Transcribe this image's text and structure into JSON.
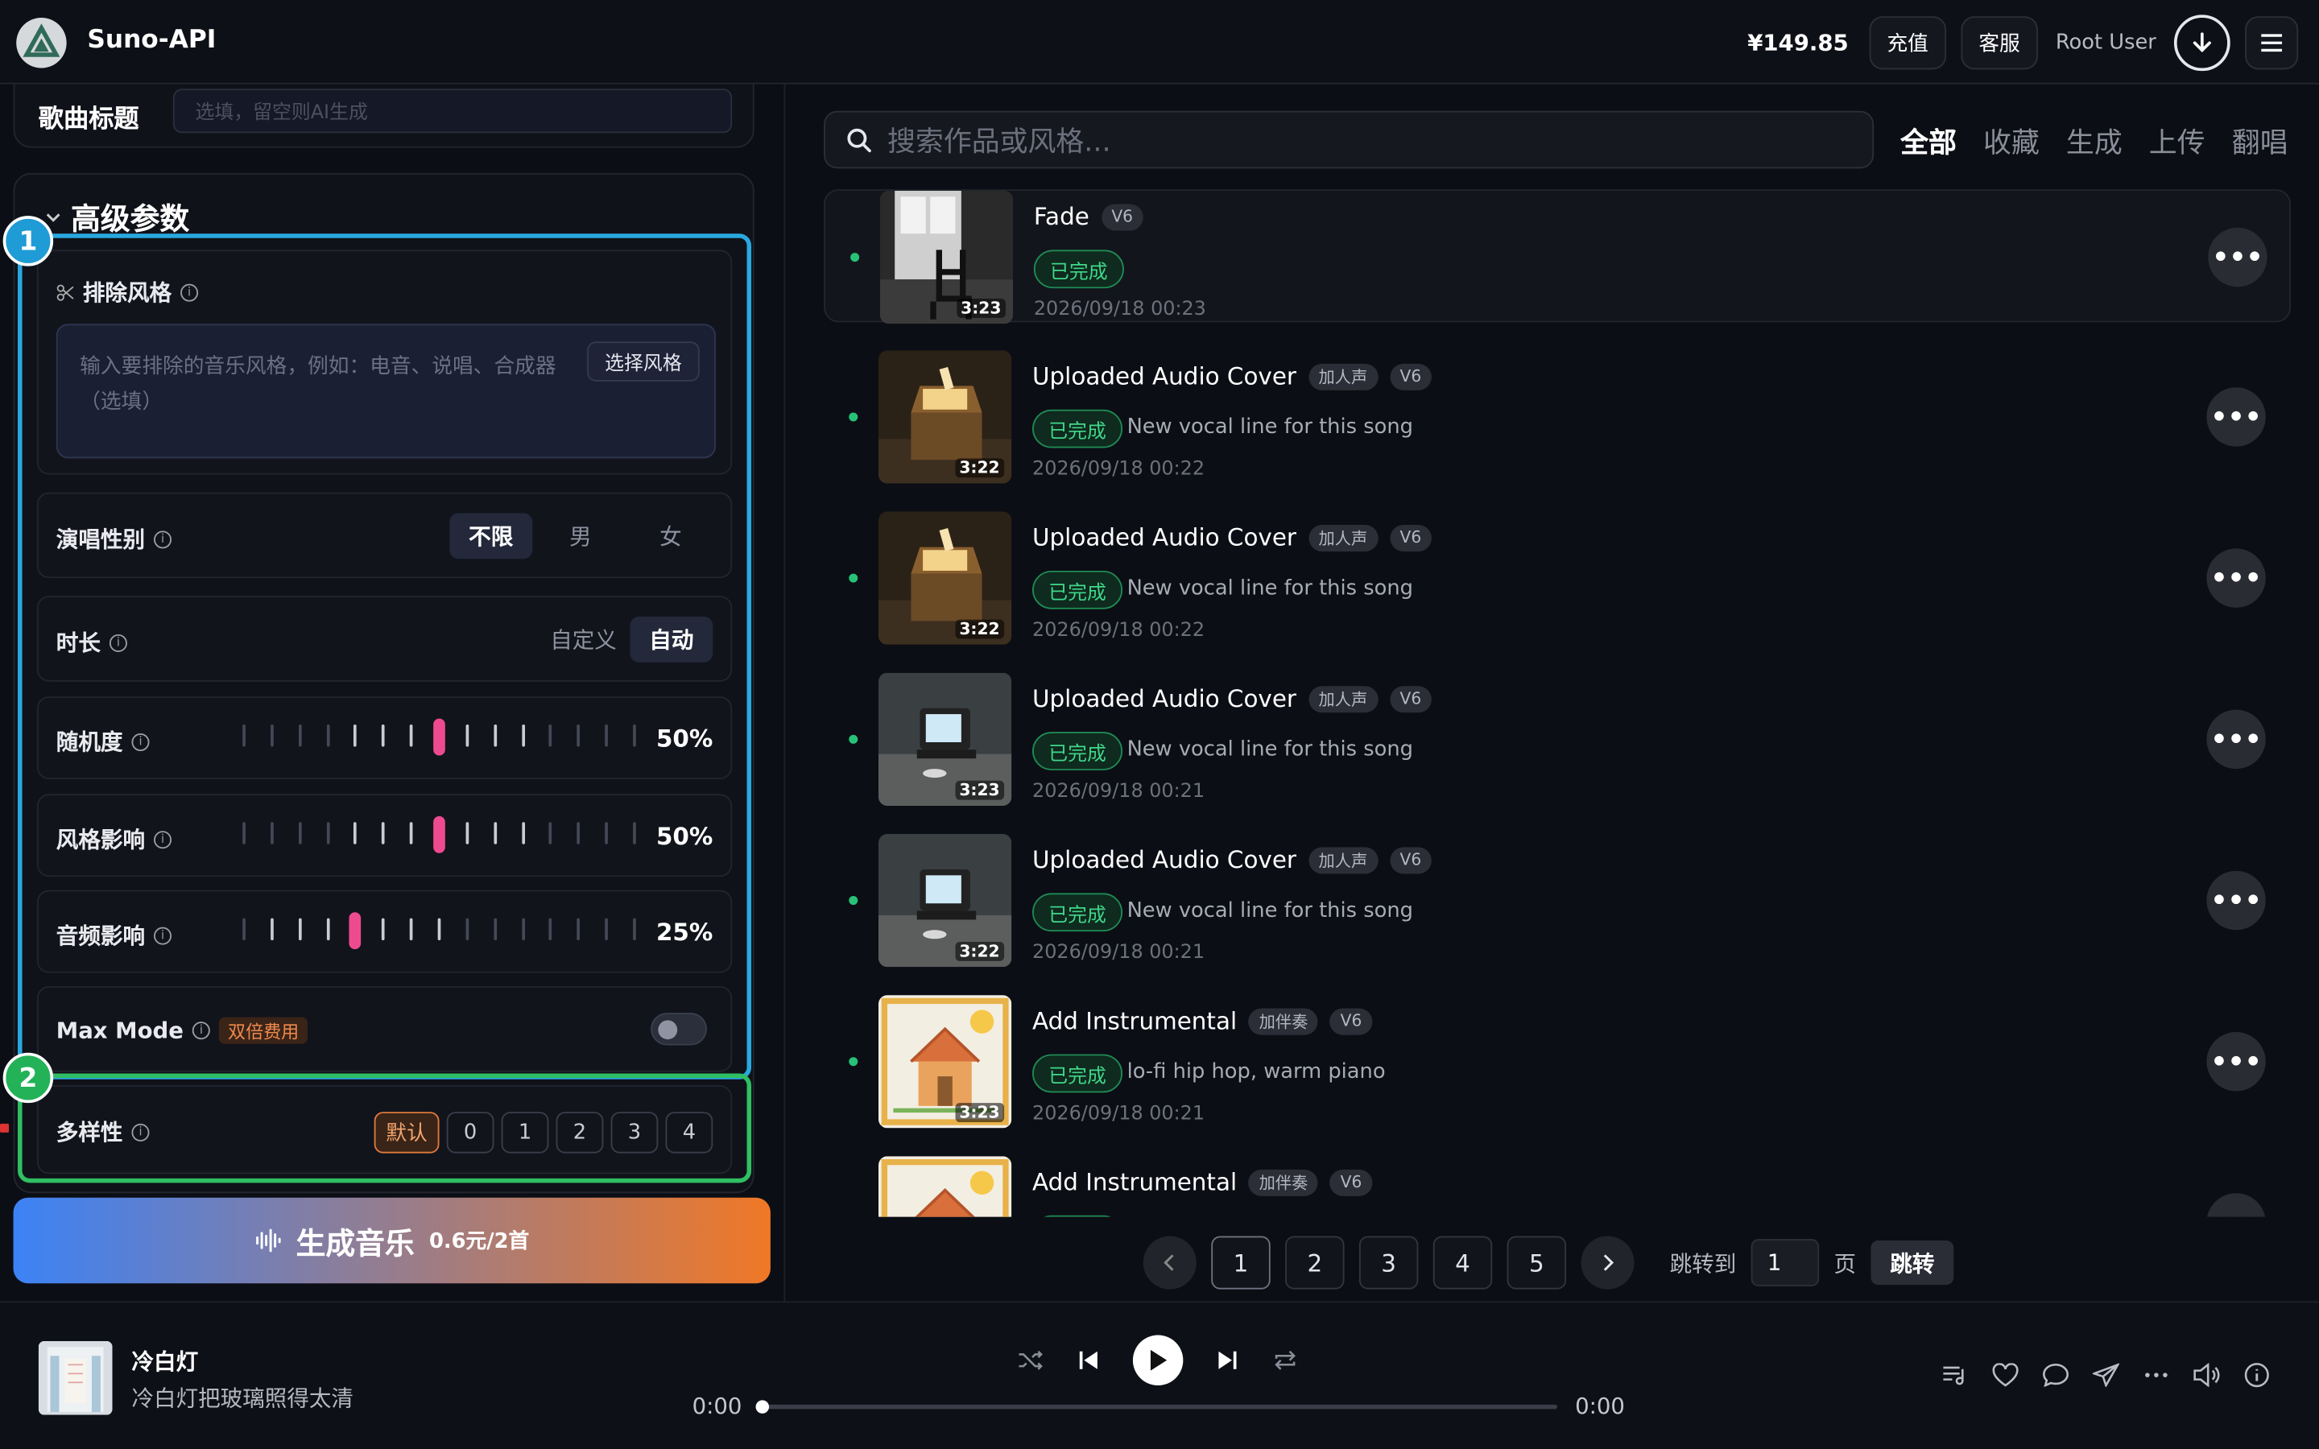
{
  "header": {
    "brand": "Suno-API",
    "balance": "¥149.85",
    "recharge_label": "充值",
    "support_label": "客服",
    "user_name": "Root User",
    "icons": [
      "logo-icon",
      "download-icon",
      "menu-icon"
    ]
  },
  "left_panel": {
    "title_field": {
      "label": "歌曲标题",
      "placeholder": "选填，留空则AI生成"
    },
    "advanced": {
      "heading": "高级参数",
      "exclude_style": {
        "label": "排除风格",
        "placeholder": "输入要排除的音乐风格，例如：电音、说唱、合成器（选填）",
        "select_button": "选择风格"
      },
      "vocal_gender": {
        "label": "演唱性别",
        "options": [
          "不限",
          "男",
          "女"
        ],
        "selected": "不限"
      },
      "duration": {
        "label": "时长",
        "options": [
          "自定义",
          "自动"
        ],
        "selected": "自动"
      },
      "randomness": {
        "label": "随机度",
        "value": "50%",
        "level": 0.5
      },
      "style_influence": {
        "label": "风格影响",
        "value": "50%",
        "level": 0.5
      },
      "audio_influence": {
        "label": "音频影响",
        "value": "25%",
        "level": 0.25
      },
      "max_mode": {
        "label": "Max Mode",
        "badge": "双倍费用",
        "enabled": false
      },
      "diversity": {
        "label": "多样性",
        "options": [
          "默认",
          "0",
          "1",
          "2",
          "3",
          "4"
        ],
        "selected": "默认"
      }
    },
    "markers": [
      "1",
      "2"
    ],
    "generate": {
      "label": "生成音乐",
      "price": "0.6元/2首"
    }
  },
  "search": {
    "placeholder": "搜索作品或风格..."
  },
  "tabs": [
    {
      "label": "全部",
      "active": true
    },
    {
      "label": "收藏",
      "active": false
    },
    {
      "label": "生成",
      "active": false
    },
    {
      "label": "上传",
      "active": false
    },
    {
      "label": "翻唱",
      "active": false
    }
  ],
  "tracks": [
    {
      "title": "Fade",
      "tags": [
        "V6"
      ],
      "status": "已完成",
      "desc": "",
      "date": "2026/09/18 00:23",
      "duration": "3:23",
      "art": "chair"
    },
    {
      "title": "Uploaded Audio Cover",
      "tags": [
        "加人声",
        "V6"
      ],
      "status": "已完成",
      "desc": "New vocal line for this song",
      "date": "2026/09/18 00:22",
      "duration": "3:22",
      "art": "chest"
    },
    {
      "title": "Uploaded Audio Cover",
      "tags": [
        "加人声",
        "V6"
      ],
      "status": "已完成",
      "desc": "New vocal line for this song",
      "date": "2026/09/18 00:22",
      "duration": "3:22",
      "art": "chest"
    },
    {
      "title": "Uploaded Audio Cover",
      "tags": [
        "加人声",
        "V6"
      ],
      "status": "已完成",
      "desc": "New vocal line for this song",
      "date": "2026/09/18 00:21",
      "duration": "3:23",
      "art": "tv"
    },
    {
      "title": "Uploaded Audio Cover",
      "tags": [
        "加人声",
        "V6"
      ],
      "status": "已完成",
      "desc": "New vocal line for this song",
      "date": "2026/09/18 00:21",
      "duration": "3:22",
      "art": "tv"
    },
    {
      "title": "Add Instrumental",
      "tags": [
        "加伴奏",
        "V6"
      ],
      "status": "已完成",
      "desc": "lo-fi hip hop, warm piano",
      "date": "2026/09/18 00:21",
      "duration": "3:23",
      "art": "house"
    },
    {
      "title": "Add Instrumental",
      "tags": [
        "加伴奏",
        "V6"
      ],
      "status": "已完成",
      "desc": "",
      "date": "",
      "duration": "",
      "art": "house"
    }
  ],
  "pagination": {
    "pages": [
      "1",
      "2",
      "3",
      "4",
      "5"
    ],
    "current": "1",
    "jump_label": "跳转到",
    "jump_value": "1",
    "page_unit": "页",
    "jump_button": "跳转"
  },
  "player": {
    "title": "冷白灯",
    "subtitle": "冷白灯把玻璃照得太清",
    "time_current": "0:00",
    "time_total": "0:00",
    "progress": 0
  }
}
